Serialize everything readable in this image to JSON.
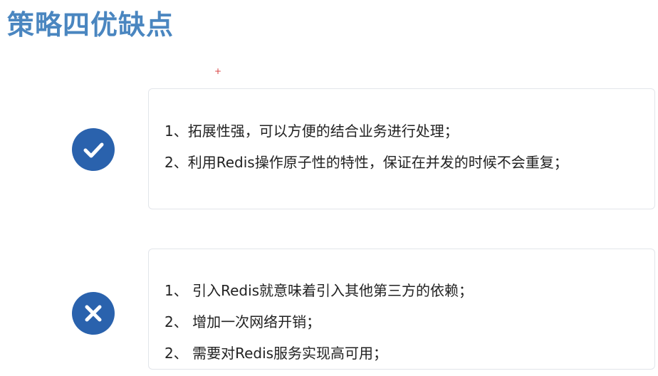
{
  "title": "策略四优缺点",
  "annotation_mark": "+",
  "pros": {
    "icon": "check-icon",
    "items": [
      "1、拓展性强，可以方便的结合业务进行处理；",
      "2、利用Redis操作原子性的特性，保证在并发的时候不会重复；"
    ]
  },
  "cons": {
    "icon": "cross-icon",
    "items": [
      "1、 引入Redis就意味着引入其他第三方的依赖；",
      "2、 增加一次网络开销；",
      "2、 需要对Redis服务实现高可用；"
    ]
  },
  "colors": {
    "title": "#4a86c0",
    "badge": "#2a62ad",
    "text": "#222222",
    "card_border": "#e2e5ea",
    "mark": "#d84040"
  }
}
